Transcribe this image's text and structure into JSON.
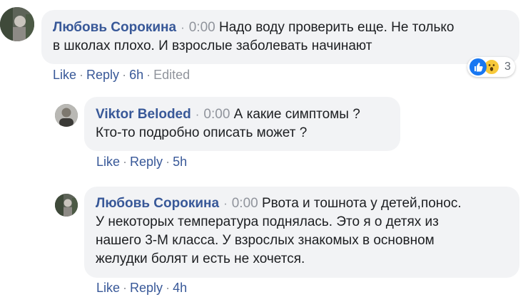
{
  "comments": [
    {
      "author": "Любовь Сорокина",
      "timestamp": "0:00",
      "lines": [
        "Надо воду проверить еще. Не только",
        "в школах плохо. И взрослые заболевать начинают"
      ],
      "actions": {
        "like": "Like",
        "reply": "Reply",
        "age": "6h",
        "edited": "Edited"
      },
      "reactions": {
        "icons": [
          "like-icon",
          "wow-icon"
        ],
        "count": "3"
      }
    },
    {
      "author": "Viktor Beloded",
      "timestamp": "0:00",
      "lines": [
        "А какие симптомы ?",
        "Кто-то подробно описать может ?"
      ],
      "actions": {
        "like": "Like",
        "reply": "Reply",
        "age": "5h"
      }
    },
    {
      "author": "Любовь Сорокина",
      "timestamp": "0:00",
      "lines": [
        "Рвота и тошнота у детей,понос.",
        "У некоторых температура поднялась. Это я о детях из",
        "нашего 3-М класса. У взрослых знакомых в основном",
        "желудки болят и есть не хочется."
      ],
      "actions": {
        "like": "Like",
        "reply": "Reply",
        "age": "4h"
      }
    }
  ],
  "separator": "·",
  "colors": {
    "author": "#385898",
    "meta": "#90949c",
    "bubble": "#f2f3f5"
  }
}
